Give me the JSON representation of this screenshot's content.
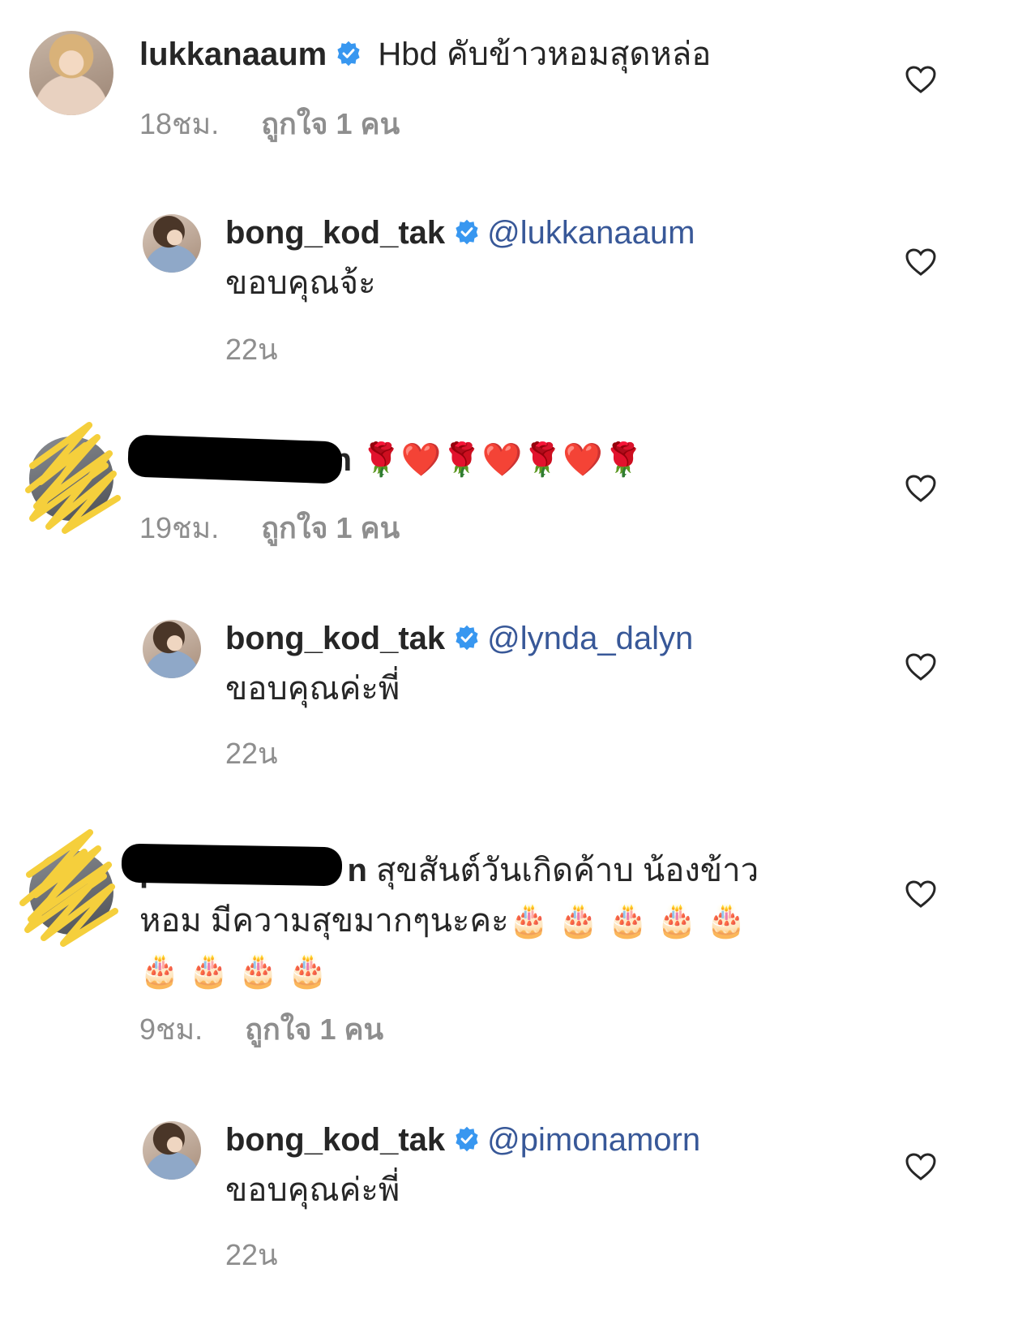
{
  "comments": [
    {
      "username": "lukkanaaum",
      "text": " Hbd คับข้าวหอมสุดหล่อ",
      "time": "18ชม.",
      "likes": "ถูกใจ 1 คน"
    },
    {
      "username": "bong_kod_tak",
      "mention": "@lukkanaaum",
      "text": "ขอบคุณจ้ะ",
      "time": "22น"
    },
    {
      "username_visible_end": "n",
      "text": " 🌹❤️🌹❤️🌹❤️🌹",
      "time": "19ชม.",
      "likes": "ถูกใจ 1 คน"
    },
    {
      "username": "bong_kod_tak",
      "mention": "@lynda_dalyn",
      "text": "ขอบคุณค่ะพี่",
      "time": "22น"
    },
    {
      "username_visible_start": "p",
      "username_visible_end": "n",
      "text_line1": " สุขสันต์วันเกิดค้าบ น้องข้าว",
      "text_line2": "หอม มีความสุขมากๆนะคะ🎂 🎂 🎂 🎂 🎂",
      "text_line3": "🎂 🎂 🎂 🎂",
      "time": "9ชม.",
      "likes": "ถูกใจ 1 คน"
    },
    {
      "username": "bong_kod_tak",
      "mention": "@pimonamorn",
      "text": "ขอบคุณค่ะพี่",
      "time": "22น"
    }
  ],
  "icons": {
    "verified": "verified-badge-icon",
    "like": "heart-outline-icon"
  },
  "colors": {
    "text": "#262626",
    "meta": "#8e8e8e",
    "mention": "#385898",
    "verified": "#3897f0",
    "scribble": "#f5cf3c"
  }
}
